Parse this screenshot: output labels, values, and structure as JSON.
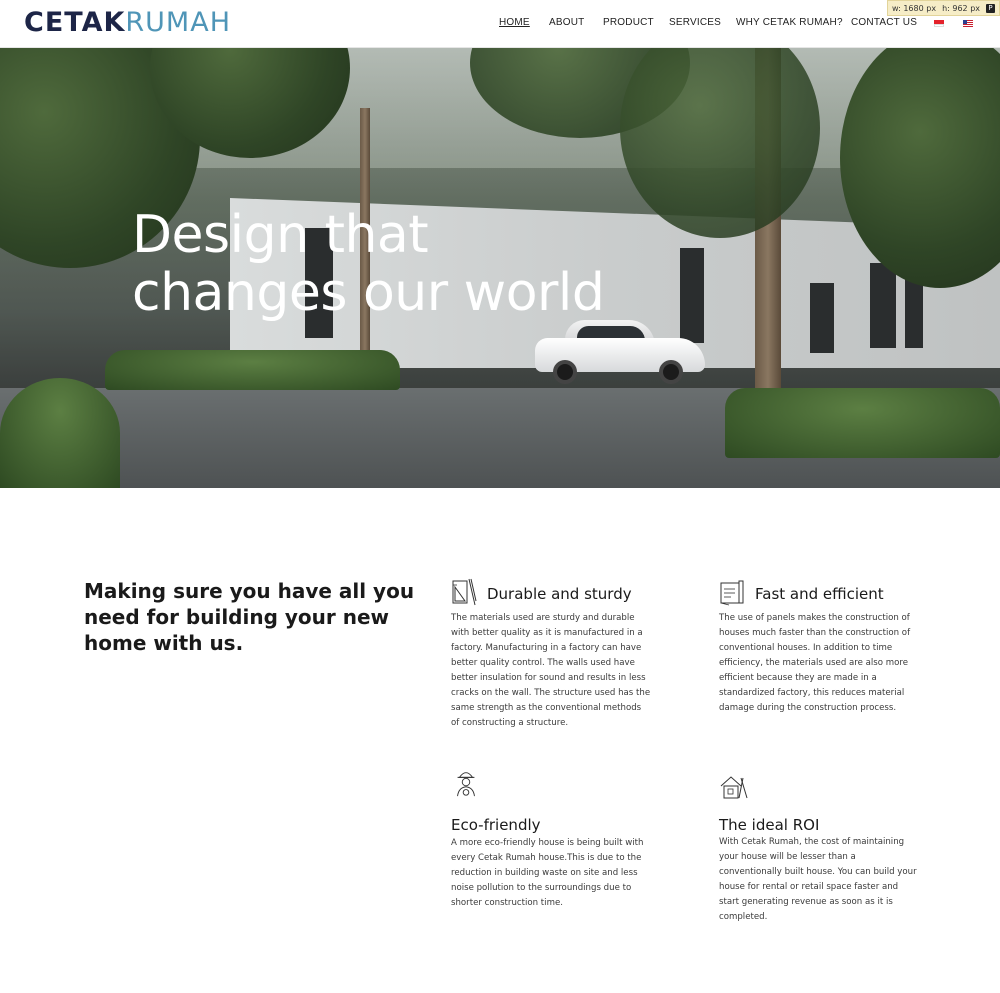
{
  "header": {
    "logo_bold": "CETAK",
    "logo_light": "RUMAH",
    "nav": [
      "HOME",
      "ABOUT",
      "PRODUCT",
      "SERVICES",
      "WHY CETAK RUMAH?",
      "CONTACT US"
    ],
    "active_nav": "HOME",
    "languages": [
      {
        "icon": "flag-indonesia-icon"
      },
      {
        "icon": "flag-usa-icon"
      }
    ]
  },
  "dimension_badge": {
    "width_label": "w: 1680",
    "width_unit": "px",
    "height_label": "h: 962",
    "height_unit": "px",
    "icon": "P"
  },
  "hero": {
    "title_line1": "Design that",
    "title_line2": "changes our world"
  },
  "features_section": {
    "intro": "Making sure you have all you need for building your new home with us.",
    "items": [
      {
        "icon": "blueprint-icon",
        "title": "Durable and sturdy",
        "text": "The materials used are sturdy and durable with better quality as it is manufactured in a factory. Manufacturing in a factory can have better quality control. The walls used have better insulation for sound and results in less cracks on the wall. The structure used has the same strength as the conventional methods of constructing a structure."
      },
      {
        "icon": "building-plans-icon",
        "title": "Fast and efficient",
        "text": "The use of panels makes the construction of houses much faster than the construction of conventional houses. In addition to time efficiency, the materials used are also more efficient because they are made in a standardized factory, this reduces material damage during the construction process."
      },
      {
        "icon": "worker-gear-icon",
        "title": "Eco-friendly",
        "text": "A more eco-friendly house is being built with every Cetak Rumah house.This is due to the reduction in building waste on site and less noise pollution to the surroundings due to shorter construction time."
      },
      {
        "icon": "house-tools-icon",
        "title": "The ideal ROI",
        "text": "With Cetak Rumah, the cost of maintaining your house will be lesser than a conventionally built house. You can build your house for rental or retail space faster and start generating revenue as soon as it is completed."
      }
    ]
  }
}
